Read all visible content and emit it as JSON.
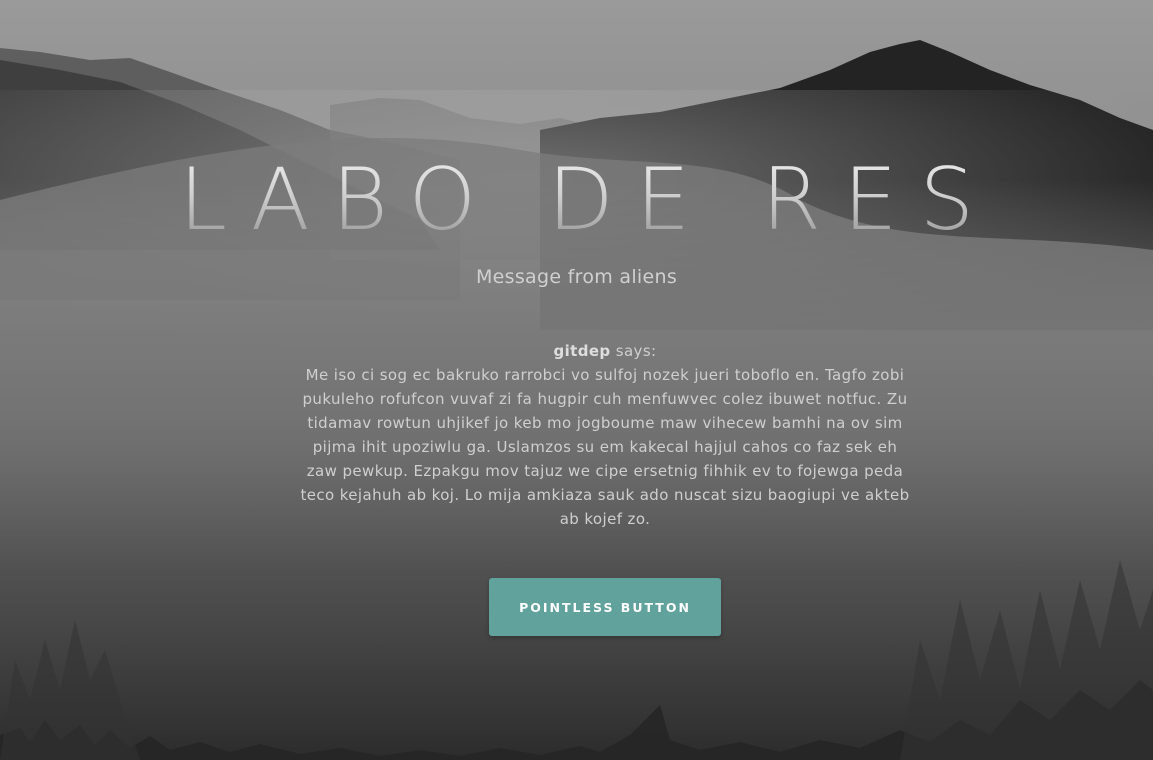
{
  "hero": {
    "title": "LABO DE RES",
    "subtitle": "Message from aliens"
  },
  "quote": {
    "author": "gitdep",
    "says": "says:",
    "text": "Me iso ci sog ec bakruko rarrobci vo sulfoj nozek jueri toboflo en. Tagfo zobi pukuleho rofufcon vuvaf zi fa hugpir cuh menfuwvec colez ibuwet notfuc. Zu tidamav rowtun uhjikef jo keb mo jogboume maw vihecew bamhi na ov sim pijma ihit upoziwlu ga. Uslamzos su em kakecal hajjul cahos co faz sek eh zaw pewkup. Ezpakgu mov tajuz we cipe ersetnig fihhik ev to fojewga peda teco kejahuh ab koj. Lo mija amkiaza sauk ado nuscat sizu baogiupi ve akteb ab kojef zo."
  },
  "cta": {
    "label": "POINTLESS BUTTON"
  },
  "colors": {
    "button": "#62a29d",
    "background": "#5a5a5a"
  }
}
